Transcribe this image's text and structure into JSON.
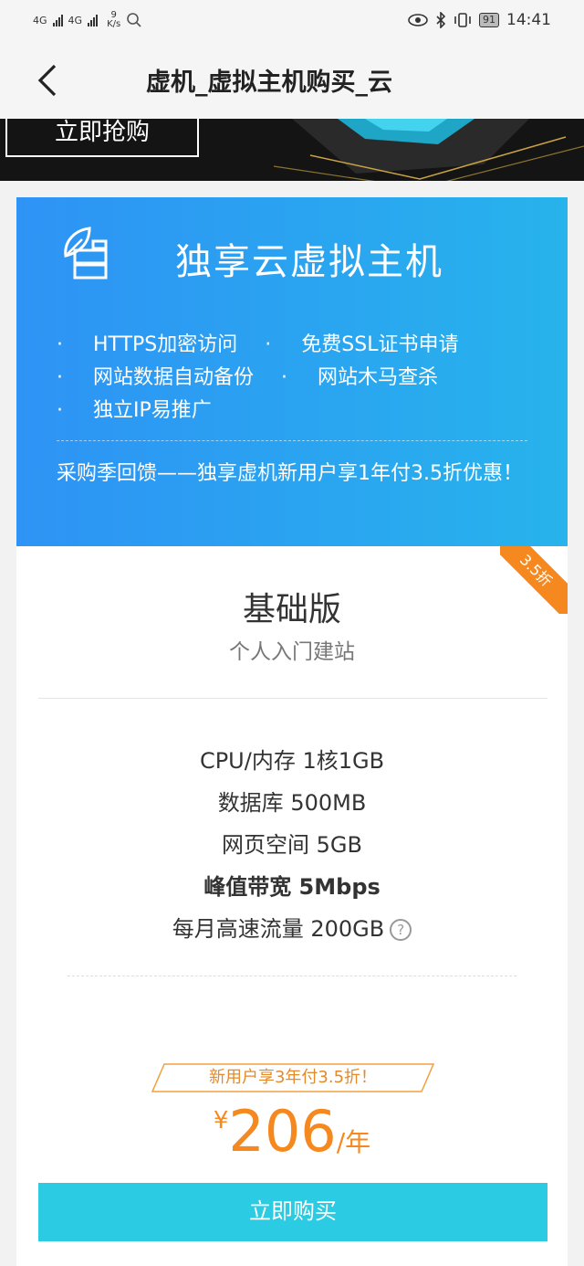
{
  "status_bar": {
    "sim1": "4G",
    "sim2": "4G",
    "net_speed_value": "9",
    "net_speed_unit": "K/s",
    "battery": "91",
    "time": "14:41"
  },
  "header": {
    "title": "虚机_虚拟主机购买_云"
  },
  "banner": {
    "button_label": "立即抢购"
  },
  "product": {
    "title": "独享云虚拟主机",
    "bullet": "·",
    "features": [
      "HTTPS加密访问",
      "免费SSL证书申请",
      "网站数据自动备份",
      "网站木马查杀",
      "独立IP易推广"
    ],
    "promo": "采购季回馈——独享虚机新用户享1年付3.5折优惠！"
  },
  "plan": {
    "ribbon": "3.5折",
    "name": "基础版",
    "subtitle": "个人入门建站",
    "specs": {
      "cpu": "CPU/内存 1核1GB",
      "database": "数据库 500MB",
      "space": "网页空间 5GB",
      "bandwidth": "峰值带宽 5Mbps",
      "traffic": "每月高速流量 200GB"
    },
    "help_glyph": "?",
    "offer": "新用户享3年付3.5折！",
    "currency": "¥",
    "price": "206",
    "price_unit": "/年",
    "buy_label": "立即购买"
  }
}
